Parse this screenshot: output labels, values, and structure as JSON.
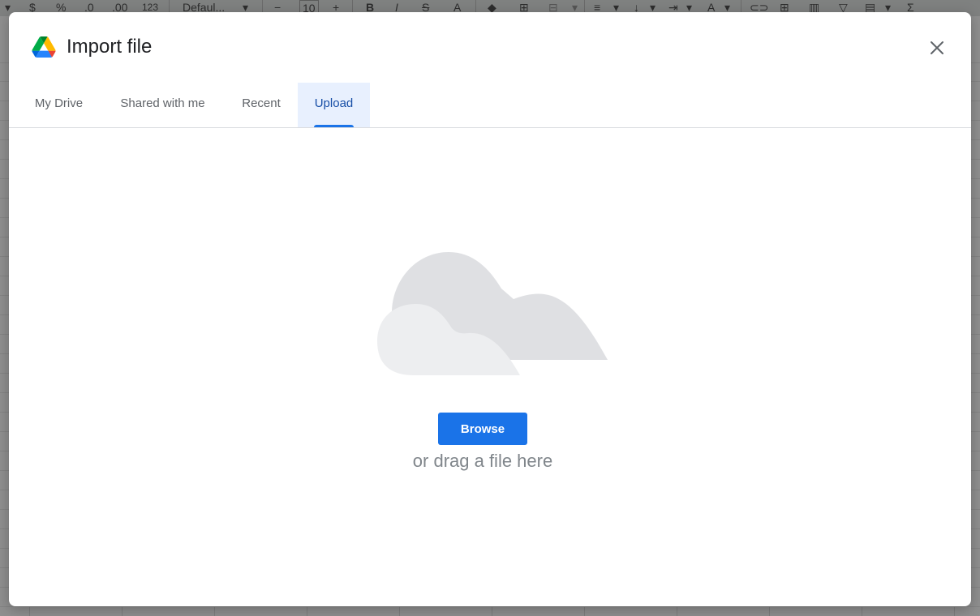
{
  "background": {
    "toolbar": {
      "currency_symbol": "$",
      "percent_symbol": "%",
      "decrease_decimal": ".0",
      "increase_decimal": ".00",
      "more_formats": "123",
      "font_family": "Defaul...",
      "font_size": "10",
      "decrease_font_size": "−",
      "increase_font_size": "+",
      "bold": "B",
      "italic": "I",
      "text_color": "A",
      "functions": "Σ"
    }
  },
  "dialog": {
    "title": "Import file",
    "tabs": [
      {
        "label": "My Drive",
        "active": false
      },
      {
        "label": "Shared with me",
        "active": false
      },
      {
        "label": "Recent",
        "active": false
      },
      {
        "label": "Upload",
        "active": true
      }
    ],
    "browse_label": "Browse",
    "drag_text": "or drag a file here"
  },
  "colors": {
    "accent": "#1a73e8",
    "active_tab_bg": "#e8f0fe",
    "active_tab_text": "#174ea6",
    "cloud_back": "#dadce0",
    "cloud_front": "#e8eaed"
  },
  "icons": {
    "logo": "google-drive-icon",
    "close": "close-icon",
    "illustration": "cloud-upload-illustration"
  }
}
